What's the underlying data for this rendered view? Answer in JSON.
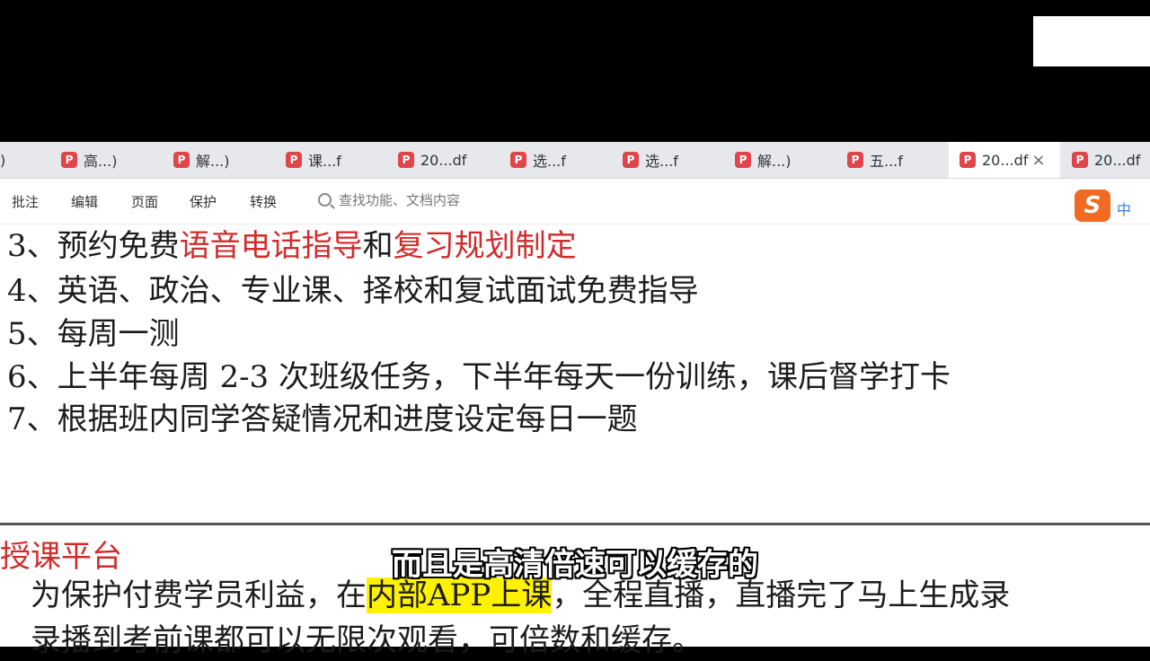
{
  "tabs": [
    {
      "label": ")",
      "active": false
    },
    {
      "label": "高...)",
      "active": false
    },
    {
      "label": "解...)",
      "active": false
    },
    {
      "label": "课...f",
      "active": false
    },
    {
      "label": "20...df",
      "active": false
    },
    {
      "label": "选...f",
      "active": false
    },
    {
      "label": "选...f",
      "active": false
    },
    {
      "label": "解...)",
      "active": false
    },
    {
      "label": "五...f",
      "active": false
    },
    {
      "label": "20...df",
      "active": true
    },
    {
      "label": "20...df",
      "active": false
    }
  ],
  "tab_close_glyph": "×",
  "menu": {
    "annotate": "批注",
    "edit": "编辑",
    "page": "页面",
    "protect": "保护",
    "convert": "转换"
  },
  "search": {
    "placeholder": "查找功能、文档内容"
  },
  "ime": {
    "logo": "S",
    "label": "中"
  },
  "document": {
    "line3": {
      "prefix": "3、预约免费",
      "red1": "语音电话指导",
      "mid": "和",
      "red2": "复习规划制定"
    },
    "line4": "4、英语、政治、专业课、择校和复试面试免费指导",
    "line5": "5、每周一测",
    "line6": "6、上半年每周 2-3 次班级任务，下半年每天一份训练，课后督学打卡",
    "line7": "7、根据班内同学答疑情况和进度设定每日一题",
    "section_title": "授课平台",
    "body1": {
      "prefix": "为保护付费学员利益，在",
      "highlight": "内部APP上课",
      "suffix": "，全程直播，直播完了马上生成录"
    },
    "body2": "录播到考前课都可以无限次观看，可倍数和缓存。"
  },
  "subtitle": "而且是高清倍速可以缓存的",
  "colors": {
    "red_text": "#d02c2c",
    "highlight": "#fff200",
    "pdf_icon": "#e0454a",
    "ime_orange": "#f06a23"
  }
}
